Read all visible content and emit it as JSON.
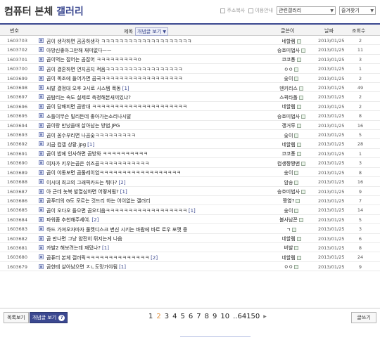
{
  "header": {
    "title_main": "컴퓨터 본체",
    "title_accent": "갤러리",
    "addr_label": "주소복사",
    "move_label": "이용안내",
    "gallery_select": "관련갤러리",
    "fav_select": "즐겨찾기"
  },
  "table": {
    "col_no": "번호",
    "col_subject": "제목",
    "concept_filter": "개념글 보기",
    "col_writer": "글쓴이",
    "col_date": "날짜",
    "col_views": "조회수"
  },
  "rows": [
    {
      "no": "1603703",
      "subject": "곰이 생각하면 곰곰하생각 ㅋㅋㅋㅋㅋㅋㅋㅋㅋㅋㅋㅋㅋㅋㅋㅋㅋㅋㅋㅋ",
      "comments": "",
      "writer": "네할렘",
      "date": "2013/01/25",
      "views": "2"
    },
    {
      "no": "1603702",
      "subject": "아방신좋아그만해 재미없다ㅡㅡ",
      "comments": "",
      "writer": "승호미법사",
      "date": "2013/01/25",
      "views": "11"
    },
    {
      "no": "1603701",
      "subject": "곰이먹는 잡어는 곰잡어 ㅋㅋㅋㅋㅋㅋㅋㅋㅋㅇ",
      "comments": "",
      "writer": "코코퐁",
      "date": "2013/01/25",
      "views": "3"
    },
    {
      "no": "1603700",
      "subject": "곰이 결혼하면 연지곰지 적음ㅋㅋㅋㅋㅋㅋㅋㅋㅋㅋㅋㅋㅋㅋㅋㅋㅋ",
      "comments": "",
      "writer": "ㅇㅇ",
      "date": "2013/01/25",
      "views": "1"
    },
    {
      "no": "1603699",
      "subject": "곰이 목조에 들어가면 곰국ㅋㅋㅋㅋㅋㅋㅋㅋㅋㅋㅋㅋㅋㅋㅋㅋㅋㅋ",
      "comments": "",
      "writer": "숯이",
      "date": "2013/01/25",
      "views": "2"
    },
    {
      "no": "1603698",
      "subject": "씨발 결정대 오후 3시로 시스템 폭동",
      "comments": "[1]",
      "writer": "덴키리스",
      "date": "2013/01/25",
      "views": "49"
    },
    {
      "no": "1603697",
      "subject": "곰탐리는 속도 실제로 측정해본새끼있냐?",
      "comments": "",
      "writer": "스퀵타폴",
      "date": "2013/01/25",
      "views": "2"
    },
    {
      "no": "1603696",
      "subject": "곰이 담배피면 곰방대 ㅋㅋㅋㅋㅋㅋㅋㅋㅋㅋㅋㅋㅋㅋㅋㅋㅋㅋㅋㅋㅋ",
      "comments": "",
      "writer": "네할렘",
      "date": "2013/01/25",
      "views": "2"
    },
    {
      "no": "1603695",
      "subject": "소틀이무슨 빌리든데 좋아가는소리나시발",
      "comments": "",
      "writer": "승호미법사",
      "date": "2013/01/25",
      "views": "8"
    },
    {
      "no": "1603694",
      "subject": "곰이랑 만났을때 살아남는 방법.JPG",
      "comments": "",
      "writer": "갱거루",
      "date": "2013/01/25",
      "views": "16"
    },
    {
      "no": "1603693",
      "subject": "곰이 꼼수부리면 나곰숯ㅋㅋㅋㅋㅋㅋㅋㅋㅋ",
      "comments": "",
      "writer": "숯이",
      "date": "2013/01/25",
      "views": "5"
    },
    {
      "no": "1603692",
      "subject": "지금 컴갤 상황.jpg",
      "comments": "[1]",
      "writer": "네할렘",
      "date": "2013/01/25",
      "views": "28"
    },
    {
      "no": "1603691",
      "subject": "곰이 밥에 인사하면 곰방와 ㅋㅋㅋㅋㅋㅋㅋㅋㅋㅋ",
      "comments": "",
      "writer": "코코퐁",
      "date": "2013/01/25",
      "views": "1"
    },
    {
      "no": "1603690",
      "subject": "여자가 키우는곰은 쉬즈곰ㅋㅋㅋㅋㅋㅋㅋㅋㅋㅋㅋ",
      "comments": "",
      "writer": "컴생짱짱맨",
      "date": "2013/01/25",
      "views": "3"
    },
    {
      "no": "1603689",
      "subject": "곰이 야동보면 곰풀레이엄ㅋㅋㅋㅋㅋㅋㅋㅋㅋㅋㅋㅋㅋㅋㅋㅋㅋㅋ",
      "comments": "",
      "writer": "숯이",
      "date": "2013/01/25",
      "views": "8"
    },
    {
      "no": "1603688",
      "subject": "이시대 최고의 그래픽카드는 뭐다?",
      "comments": "[2]",
      "writer": "암송",
      "date": "2013/01/25",
      "views": "16"
    },
    {
      "no": "1603687",
      "subject": "아 근데 놋북 발열심하면 어떻게됨?",
      "comments": "[1]",
      "writer": "승호미법사",
      "date": "2013/01/25",
      "views": "9"
    },
    {
      "no": "1603686",
      "subject": "곰푸터의 G도 모르는 것드리 하는 어이없는 갤러리",
      "comments": "",
      "writer": "짱옆?",
      "date": "2013/01/25",
      "views": "7"
    },
    {
      "no": "1603685",
      "subject": "곰이 오다오 들으면 곰오디움ㅋㅋㅋㅋㅋㅋㅋㅋㅋㅋㅋㅋㅋㅋㅋㅋㅋㅋ",
      "comments": "[1]",
      "writer": "숯이",
      "date": "2013/01/25",
      "views": "14"
    },
    {
      "no": "1603684",
      "subject": "파워좀 추천해주세여.",
      "comments": "[2]",
      "writer": "볼사남꼰",
      "date": "2013/01/25",
      "views": "5"
    },
    {
      "no": "1603683",
      "subject": "하드 가져오자마자 풀켓디스크 변신 시키는 바람에 바로 로우 포맷 중",
      "comments": "",
      "writer": "ㄱ",
      "date": "2013/01/25",
      "views": "3"
    },
    {
      "no": "1603682",
      "subject": "곰 만나면 그냥 얌전히 뒤지는게 나음",
      "comments": "",
      "writer": "네할렘",
      "date": "2013/01/25",
      "views": "6"
    },
    {
      "no": "1603681",
      "subject": "카발2 해보려는데 재밌나?",
      "comments": "[1]",
      "writer": "버발",
      "date": "2013/01/25",
      "views": "8"
    },
    {
      "no": "1603680",
      "subject": "곰퓨터 본체 갤러릭ㅋㅋㅋㅋㅋㅋㅋㅋㅋㅋㅋㅋㅋㅋ",
      "comments": "[2]",
      "writer": "네할렘",
      "date": "2013/01/25",
      "views": "24"
    },
    {
      "no": "1603679",
      "subject": "곰한테 살아남으면 ㅈㄴ도망가야됨",
      "comments": "[1]",
      "writer": "ㅇㅇ",
      "date": "2013/01/25",
      "views": "9"
    }
  ],
  "footer": {
    "list_button": "목록보기",
    "concept_button": "개념글 보기",
    "concept_help": "?",
    "write_button": "글쓰기",
    "pages": [
      "1",
      "2",
      "3",
      "4",
      "5",
      "6",
      "7",
      "8",
      "9",
      "10"
    ],
    "current_page": "2",
    "ellipsis_last": "..64150",
    "next_symbol": "▶"
  }
}
